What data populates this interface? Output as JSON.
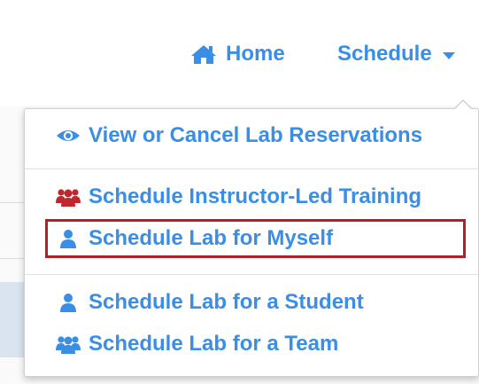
{
  "nav": {
    "home": {
      "label": "Home",
      "icon": "home-icon"
    },
    "schedule": {
      "label": "Schedule",
      "icon": "caret-down-icon"
    }
  },
  "dropdown": {
    "items": [
      {
        "label": "View or Cancel Lab Reservations",
        "icon": "eye-icon"
      },
      {
        "label": "Schedule Instructor-Led Training",
        "icon": "group-icon",
        "icon_color": "#c0262b"
      },
      {
        "label": "Schedule Lab for Myself",
        "icon": "user-icon",
        "highlighted": true
      },
      {
        "label": "Schedule Lab for a Student",
        "icon": "user-icon"
      },
      {
        "label": "Schedule Lab for a Team",
        "icon": "group-icon"
      }
    ]
  },
  "colors": {
    "link": "#3a8ee6",
    "highlight_border": "#b22026",
    "training_icon": "#c0262b"
  }
}
